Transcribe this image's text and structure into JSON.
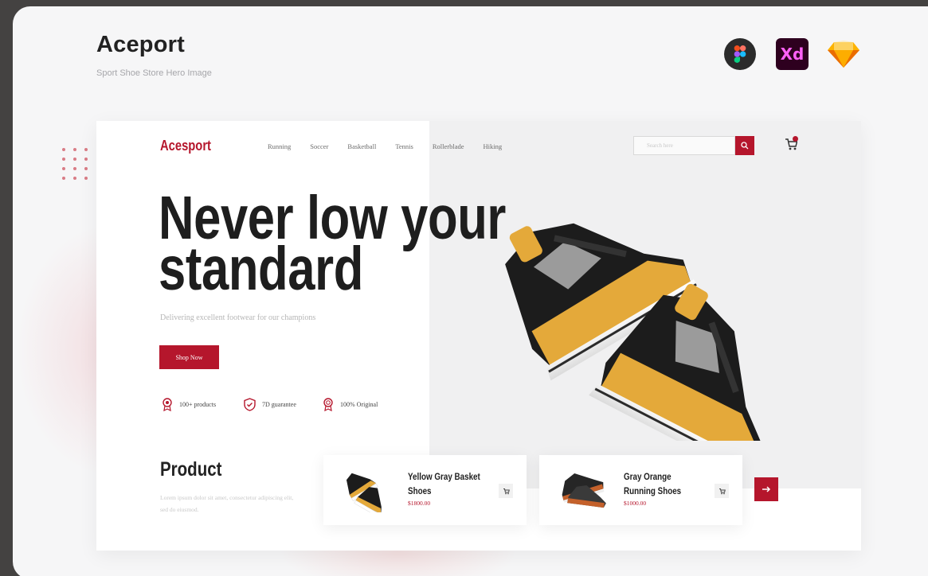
{
  "showcase": {
    "title": "Aceport",
    "subtitle": "Sport Shoe Store Hero Image",
    "tools": [
      "figma-icon",
      "adobe-xd-icon",
      "sketch-icon"
    ],
    "xd_label": "Xd"
  },
  "site": {
    "logo": "Acesport",
    "nav": [
      "Running",
      "Soccer",
      "Basketball",
      "Tennis",
      "Rollerblade",
      "Hiking"
    ],
    "search_placeholder": "Search here",
    "accent": "#b5162c"
  },
  "hero": {
    "headline_line1": "Never low your",
    "headline_line2": "standard",
    "tagline": "Delivering excellent footwear for our champions",
    "cta": "Shop Now",
    "features": [
      {
        "icon": "badge-icon",
        "label": "100+ products"
      },
      {
        "icon": "shield-icon",
        "label": "7D guarantee"
      },
      {
        "icon": "award-icon",
        "label": "100% Original"
      }
    ]
  },
  "products": {
    "title": "Product",
    "description": "Lorem ipsum dolor sit amet, consectetur adipiscing elit, sed do eiusmod.",
    "items": [
      {
        "name": "Yellow Gray Basket Shoes",
        "price": "$1800.00"
      },
      {
        "name": "Gray Orange Running Shoes",
        "price": "$1000.00"
      }
    ]
  }
}
